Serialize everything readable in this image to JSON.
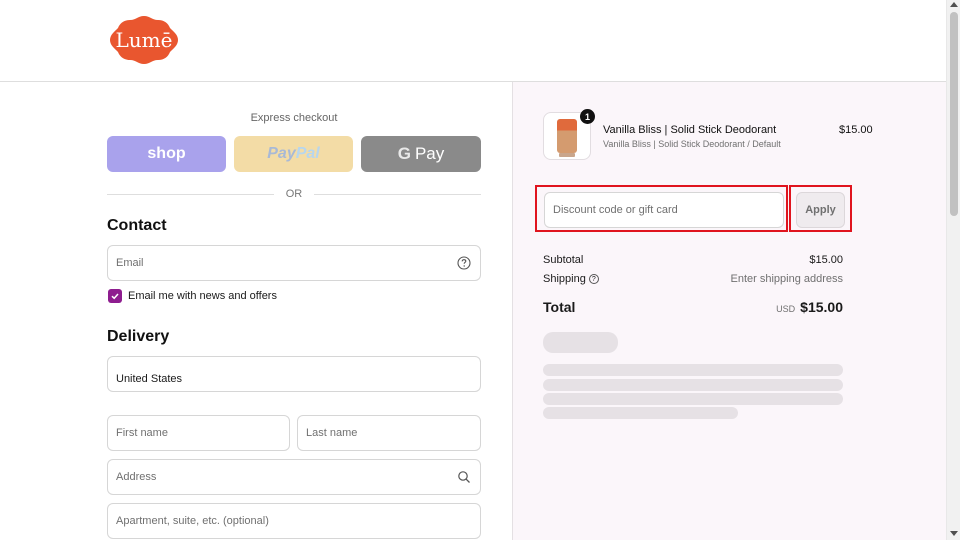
{
  "header": {
    "logo_text": "Lumē",
    "brand_color": "#e9562f"
  },
  "express": {
    "label": "Express checkout",
    "shop_label": "shop",
    "paypal_label_1": "Pay",
    "paypal_label_2": "Pal",
    "gpay_g": "G",
    "gpay_label": "Pay",
    "or_label": "OR"
  },
  "contact": {
    "title": "Contact",
    "email_placeholder": "Email",
    "newsletter_label": "Email me with news and offers",
    "newsletter_checked": true
  },
  "delivery": {
    "title": "Delivery",
    "country_value": "United States",
    "first_name_placeholder": "First name",
    "last_name_placeholder": "Last name",
    "address_placeholder": "Address",
    "apartment_placeholder": "Apartment, suite, etc. (optional)"
  },
  "summary": {
    "item": {
      "name": "Vanilla Bliss | Solid Stick Deodorant",
      "variant": "Vanilla Bliss | Solid Stick Deodorant / Default",
      "price": "$15.00",
      "quantity": "1"
    },
    "discount_placeholder": "Discount code or gift card",
    "apply_label": "Apply",
    "subtotal_label": "Subtotal",
    "subtotal_value": "$15.00",
    "shipping_label": "Shipping",
    "shipping_value": "Enter shipping address",
    "total_label": "Total",
    "total_currency": "USD",
    "total_value": "$15.00"
  },
  "colors": {
    "highlight": "#e0141e",
    "checkbox": "#8e1d8f",
    "summary_bg": "#fbf6fa"
  }
}
